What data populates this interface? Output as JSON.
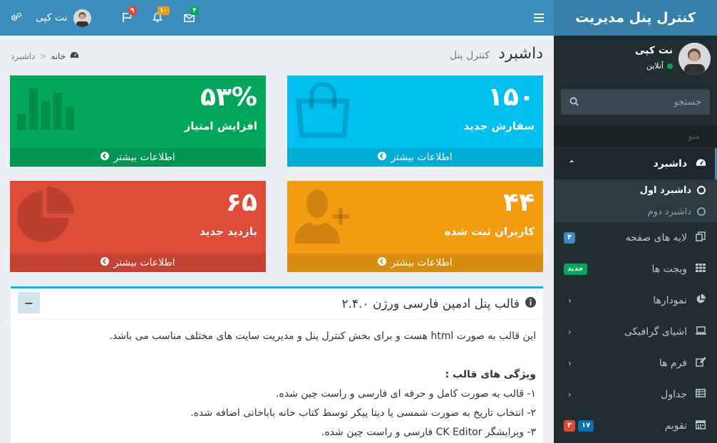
{
  "sidebar": {
    "logo": "کنترل پنل مدیریت",
    "user_name": "نت کپی",
    "user_status": "آنلاین",
    "search_placeholder": "جستجو",
    "menu_header": "منو",
    "items": [
      {
        "label": "داشبرد",
        "icon": "dashboard-icon"
      },
      {
        "label": "لایه های صفحه",
        "icon": "files-icon",
        "badge": "۴"
      },
      {
        "label": "ویجت ها",
        "icon": "grid-icon",
        "badge": "جدید"
      },
      {
        "label": "نمودارها",
        "icon": "pie-chart-icon"
      },
      {
        "label": "اشیای گرافیکی",
        "icon": "laptop-icon"
      },
      {
        "label": "فرم ها",
        "icon": "edit-icon"
      },
      {
        "label": "جداول",
        "icon": "table-icon"
      },
      {
        "label": "تقویم",
        "icon": "calendar-icon",
        "badges": [
          "۱۷",
          "۳"
        ]
      }
    ],
    "submenu": [
      "داشبرد اول",
      "داشبرد دوم"
    ]
  },
  "topbar": {
    "mail_count": "۴",
    "notif_count": "۱۰",
    "flag_count": "۹",
    "user_name": "نت کپی"
  },
  "content": {
    "title": "داشبرد",
    "subtitle": "کنترل پنل",
    "breadcrumb": {
      "home": "خانه",
      "sep": ">",
      "current": "داشبرد"
    },
    "more_info": "اطلاعات بیشتر",
    "boxes": [
      {
        "value": "۱۵۰",
        "label": "سفارش جدید",
        "color": "#00c0ef"
      },
      {
        "value": "۵۳%",
        "label": "افزایش امتیاز",
        "color": "#00a65a"
      },
      {
        "value": "۴۴",
        "label": "کاربران ثبت شده",
        "color": "#f39c12"
      },
      {
        "value": "۶۵",
        "label": "بازدید جدید",
        "color": "#dd4b39"
      }
    ],
    "panel": {
      "title": "قالب پنل ادمین فارسی ورژن ۲.۴.۰",
      "collapse": "−",
      "intro": "این قالب به صورت html هست و برای بخش کنترل پنل و مدیریت سایت های مختلف مناسب می باشد.",
      "features_title": "ویژگی های قالب :",
      "features": [
        "۱- قالب به صورت کامل و حرفه ای فارسی و راست چین شده.",
        "۲- انتخاب تاریخ به صورت شمسی یا دیتا پیکر توسط کتاب خانه باباخانی اضافه شده.",
        "۳- ویرایشگر CK Editor فارسی و راست چین شده."
      ]
    }
  }
}
